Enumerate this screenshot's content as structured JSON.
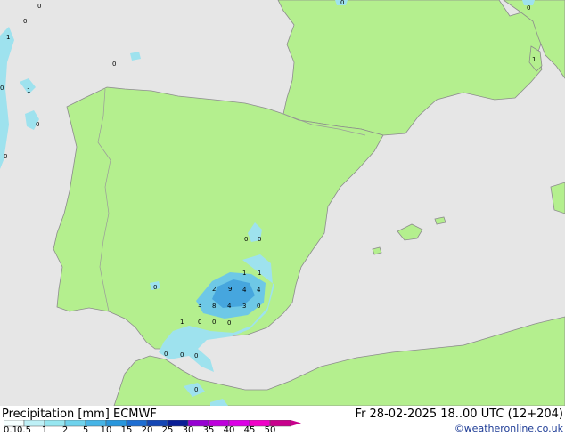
{
  "map": {
    "colors": {
      "sea": "#e6e6e6",
      "land": "#b4ef8e",
      "coast": "#8c8c8c",
      "border": "#9a9a9a",
      "precip_light": "#9ee2ee",
      "precip_mid": "#6ec8e6",
      "precip_heavy": "#46a6de"
    },
    "values": [
      "0",
      "0",
      "1",
      "1",
      "0",
      "0",
      "0",
      "0",
      "0",
      "0",
      "1",
      "0",
      "0",
      "1",
      "2",
      "9",
      "4",
      "4",
      "3",
      "8",
      "4",
      "3",
      "0",
      "1",
      "0",
      "0",
      "0",
      "1",
      "0",
      "0",
      "0",
      "0",
      "0"
    ]
  },
  "footer": {
    "title": "Precipitation [mm] ECMWF",
    "valid": "Fr 28-02-2025 18..00 UTC (12+204)",
    "credit": "©weatheronline.co.uk",
    "scale": {
      "labels": [
        "0.1",
        "0.5",
        "1",
        "2",
        "5",
        "10",
        "15",
        "20",
        "25",
        "30",
        "35",
        "40",
        "45",
        "50"
      ],
      "colors": [
        "#f5ffff",
        "#bef0f6",
        "#96e6f0",
        "#6ed2ec",
        "#46b4e6",
        "#2896dc",
        "#1e6ed2",
        "#1446b4",
        "#0a1e96",
        "#9600d2",
        "#be00dc",
        "#dc00e6",
        "#f000c8",
        "#c8008c"
      ]
    }
  }
}
